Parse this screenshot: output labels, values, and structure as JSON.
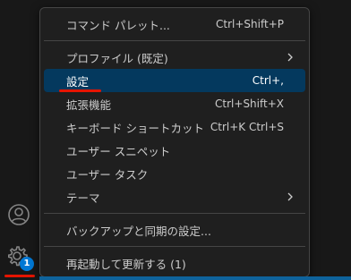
{
  "menu": {
    "items": [
      {
        "label": "コマンド パレット...",
        "shortcut": "Ctrl+Shift+P"
      },
      {
        "label": "プロファイル (既定)",
        "shortcut": "",
        "submenu": true
      },
      {
        "label": "設定",
        "shortcut": "Ctrl+,",
        "active": true
      },
      {
        "label": "拡張機能",
        "shortcut": "Ctrl+Shift+X"
      },
      {
        "label": "キーボード ショートカット",
        "shortcut": "Ctrl+K Ctrl+S"
      },
      {
        "label": "ユーザー スニペット",
        "shortcut": ""
      },
      {
        "label": "ユーザー タスク",
        "shortcut": ""
      },
      {
        "label": "テーマ",
        "shortcut": "",
        "submenu": true
      },
      {
        "label": "バックアップと同期の設定...",
        "shortcut": ""
      },
      {
        "label": "再起動して更新する (1)",
        "shortcut": ""
      }
    ]
  },
  "activity_bar": {
    "account_icon": "account-icon",
    "manage_icon": "gear-icon",
    "manage_badge": "1"
  },
  "colors": {
    "background": "#181818",
    "menu_background": "#1f1f1f",
    "active_item": "#04395e",
    "badge": "#0078d4",
    "annotation_red": "#e51400"
  }
}
